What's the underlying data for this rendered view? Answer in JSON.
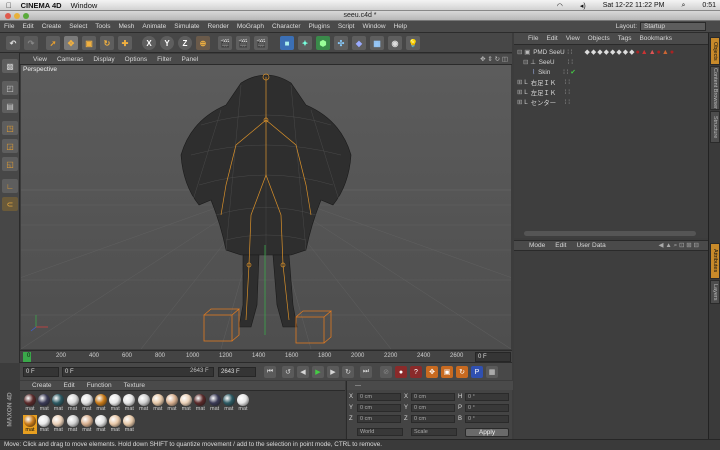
{
  "mac_menu": {
    "app": "CINEMA 4D",
    "items": [
      "Window"
    ]
  },
  "mac_status": {
    "datetime": "Sat 12-22  11:22 PM",
    "battery": "0:51"
  },
  "window": {
    "title": "seeu.c4d *"
  },
  "menubar": {
    "items": [
      "File",
      "Edit",
      "Create",
      "Select",
      "Tools",
      "Mesh",
      "Animate",
      "Simulate",
      "Render",
      "MoGraph",
      "Character",
      "Plugins",
      "Script",
      "Window",
      "Help"
    ],
    "layout_label": "Layout:",
    "layout_value": "Startup"
  },
  "viewport": {
    "menu": [
      "View",
      "Cameras",
      "Display",
      "Options",
      "Filter",
      "Panel"
    ],
    "label": "Perspective"
  },
  "timeline": {
    "ticks": [
      "0",
      "200",
      "400",
      "600",
      "800",
      "1000",
      "1200",
      "1400",
      "1600",
      "1800",
      "2000",
      "2200",
      "2400",
      "2600"
    ],
    "end_field": "0 F"
  },
  "playbar": {
    "current": "0 F",
    "start": "0 F",
    "end_range": "2643 F",
    "max": "2643 F"
  },
  "material_manager": {
    "menu": [
      "Create",
      "Edit",
      "Function",
      "Texture"
    ],
    "label": "mat",
    "selected_index": 16,
    "colors": [
      "#5a2a2a",
      "#3a3a55",
      "#2c5a63",
      "#d8d8d8",
      "#e0e0e0",
      "#c87a18",
      "#e8e8e8",
      "#e4e4e4",
      "#d0d0d0",
      "#e6c8a8",
      "#d8b090",
      "#ead0b8",
      "#5a2a2a",
      "#3a3a55",
      "#2c5a63",
      "#e4e4e4",
      "#c87a18",
      "#e8e8e8",
      "#ead0b8",
      "#d0d0d0",
      "#d8b090",
      "#e0e0e0",
      "#e8c8a8",
      "#e6c8a8"
    ]
  },
  "coordinates": {
    "header": "---",
    "rows": [
      {
        "a": "X",
        "av": "0 cm",
        "b": "X",
        "bv": "0 cm",
        "c": "H",
        "cv": "0 °"
      },
      {
        "a": "Y",
        "av": "0 cm",
        "b": "Y",
        "bv": "0 cm",
        "c": "P",
        "cv": "0 °"
      },
      {
        "a": "Z",
        "av": "0 cm",
        "b": "Z",
        "bv": "0 cm",
        "c": "B",
        "cv": "0 °"
      }
    ],
    "mode1": "World",
    "mode2": "Scale",
    "apply": "Apply"
  },
  "object_manager": {
    "menu": [
      "File",
      "Edit",
      "View",
      "Objects",
      "Tags",
      "Bookmarks"
    ],
    "objects": [
      {
        "name": "PMD SeeU",
        "indent": 0
      },
      {
        "name": "SeeU",
        "indent": 1
      },
      {
        "name": "Skin",
        "indent": 2
      },
      {
        "name": "右足ＩＫ",
        "indent": 0
      },
      {
        "name": "左足ＩＫ",
        "indent": 0
      },
      {
        "name": "センター",
        "indent": 0
      }
    ]
  },
  "attribute_manager": {
    "menu": [
      "Mode",
      "Edit",
      "User Data"
    ]
  },
  "side_tabs": [
    "Objects",
    "Content Browser",
    "Structure",
    "Attributes",
    "Layers"
  ],
  "status": {
    "text": "Move: Click and drag to move elements. Hold down SHIFT to quantize movement / add to the selection in point mode, CTRL to remove."
  }
}
